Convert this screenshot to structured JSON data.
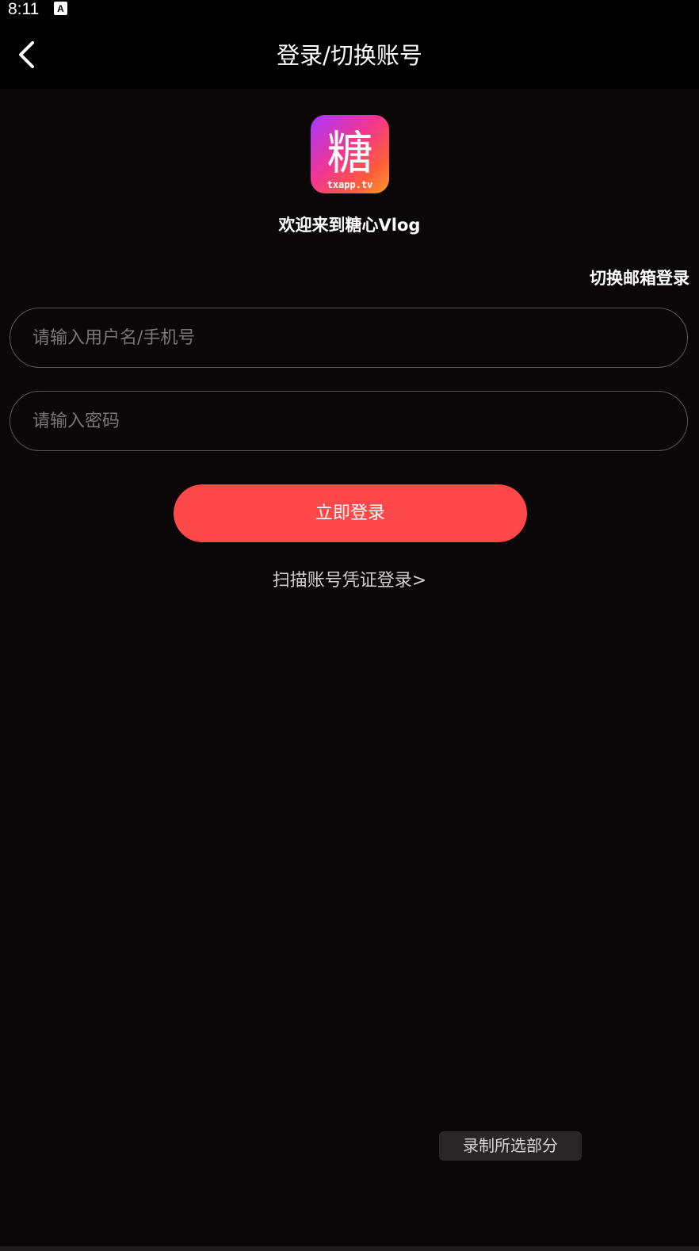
{
  "status_bar": {
    "time": "8:11",
    "notification_icon": "font-a-icon"
  },
  "header": {
    "back_icon": "chevron-left-icon",
    "title": "登录/切换账号"
  },
  "brand": {
    "logo_icon": "tang-app-logo",
    "logo_char": "糖",
    "logo_domain": "txapp.tv",
    "welcome": "欢迎来到糖心Vlog"
  },
  "login": {
    "switch_mode_label": "切换邮箱登录",
    "username_placeholder": "请输入用户名/手机号",
    "username_value": "",
    "password_placeholder": "请输入密码",
    "password_value": "",
    "submit_label": "立即登录",
    "scan_label": "扫描账号凭证登录>"
  },
  "overlay": {
    "record_label": "录制所选部分"
  },
  "colors": {
    "background": "#0b0709",
    "header": "#000000",
    "accent": "#ff4849",
    "field_border": "#5c5659"
  }
}
